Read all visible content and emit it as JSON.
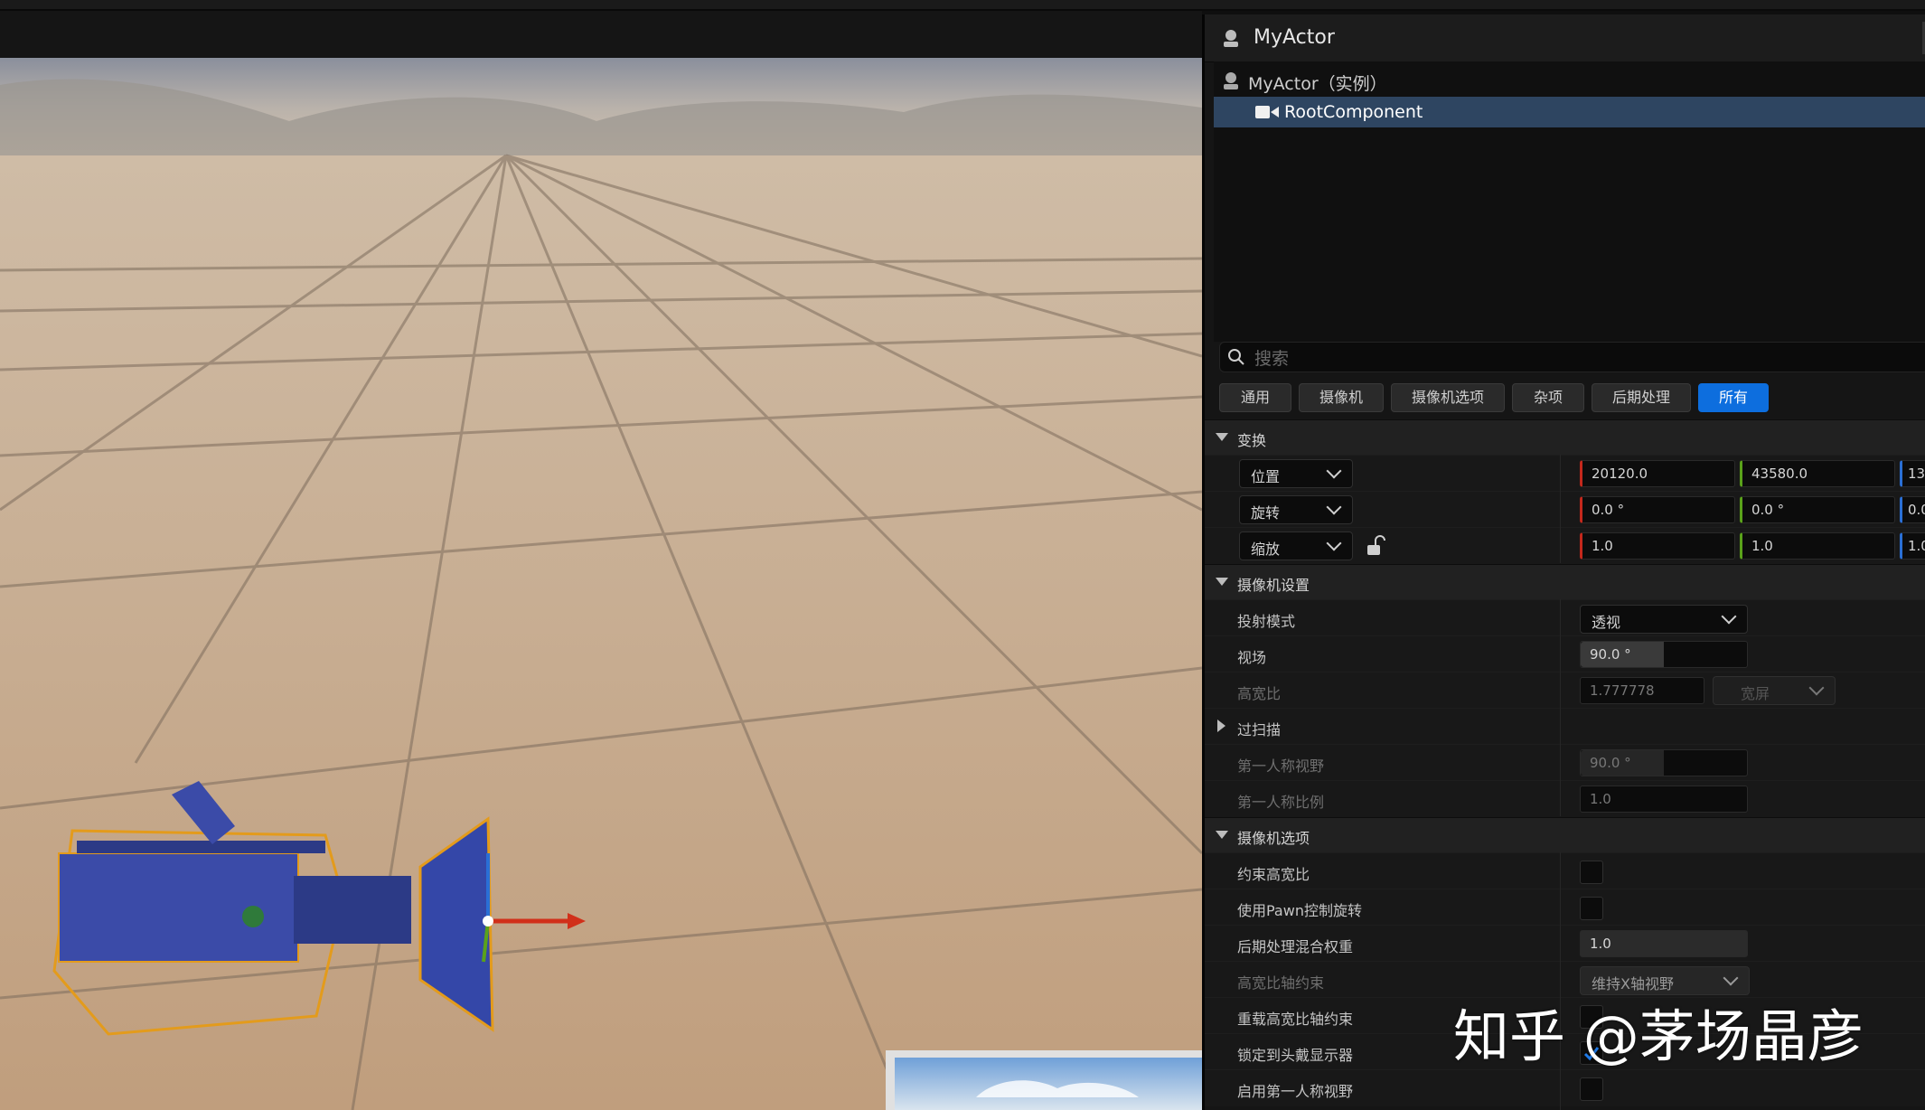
{
  "panel": {
    "title": "MyActor",
    "tree": {
      "root_label": "MyActor（实例）",
      "component_label": "RootComponent"
    },
    "search_placeholder": "搜索",
    "filter_tabs": [
      "通用",
      "摄像机",
      "摄像机选项",
      "杂项",
      "后期处理",
      "所有"
    ],
    "active_tab": "所有",
    "transform": {
      "section": "变换",
      "location": {
        "label": "位置",
        "x": "20120.0",
        "y": "43580.0",
        "z": "13"
      },
      "rotation": {
        "label": "旋转",
        "x": "0.0 °",
        "y": "0.0 °",
        "z": "0.0"
      },
      "scale": {
        "label": "缩放",
        "x": "1.0",
        "y": "1.0",
        "z": "1.0"
      }
    },
    "camera_settings": {
      "section": "摄像机设置",
      "projection_mode": {
        "label": "投射模式",
        "value": "透视"
      },
      "fov": {
        "label": "视场",
        "value": "90.0 °"
      },
      "aspect_ratio": {
        "label": "高宽比",
        "value": "1.777778",
        "preset": "宽屏"
      },
      "overscan": {
        "label": "过扫描"
      },
      "first_person_fov": {
        "label": "第一人称视野",
        "value": "90.0 °"
      },
      "first_person_scale": {
        "label": "第一人称比例",
        "value": "1.0"
      }
    },
    "camera_options": {
      "section": "摄像机选项",
      "constrain_aspect": {
        "label": "约束高宽比",
        "checked": false
      },
      "use_pawn_rotation": {
        "label": "使用Pawn控制旋转",
        "checked": false
      },
      "post_process_weight": {
        "label": "后期处理混合权重",
        "value": "1.0"
      },
      "aspect_axis_constraint": {
        "label": "高宽比轴约束",
        "value": "维持X轴视野"
      },
      "override_aspect_axis": {
        "label": "重载高宽比轴约束",
        "checked": false
      },
      "lock_to_hmd": {
        "label": "锁定到头戴显示器",
        "checked": true
      },
      "enable_first_person_fov": {
        "label": "启用第一人称视野",
        "checked": false
      }
    }
  },
  "fov_fill_fraction": 0.5,
  "watermark": "知乎 @茅场晶彦",
  "colors": {
    "accent": "#0d6ede",
    "selection": "#2e4561",
    "x_axis": "#c4281c",
    "y_axis": "#5aa21a",
    "z_axis": "#2a6fd6"
  }
}
